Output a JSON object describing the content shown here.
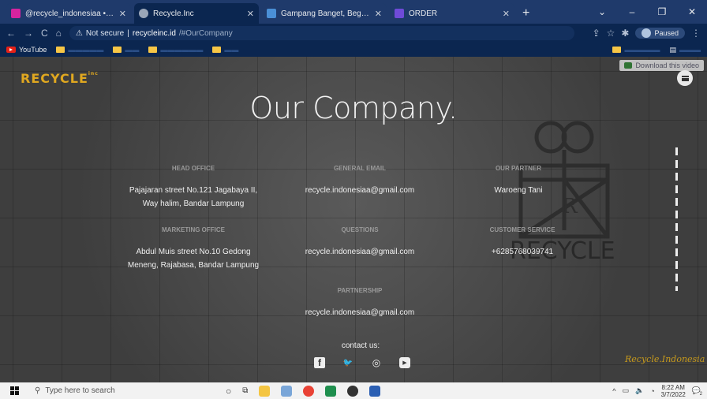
{
  "browser": {
    "tabs": [
      {
        "title": "@recycle_indonesiaa • Foto dan",
        "favicon_color": "#d6249f",
        "active": false
      },
      {
        "title": "Recycle.Inc",
        "favicon_color": "#9aa6b8",
        "active": true
      },
      {
        "title": "Gampang Banget, Begini Cara M",
        "favicon_color": "#4a8fd6",
        "active": false
      },
      {
        "title": "ORDER",
        "favicon_color": "#6f4bd8",
        "active": false
      }
    ],
    "new_tab_label": "+",
    "address": {
      "security": "Not secure",
      "host": "recycleinc.id",
      "path": "/#OurCompany"
    },
    "profile_status": "Paused",
    "bookmarks": [
      {
        "label": "YouTube",
        "type": "youtube"
      },
      {
        "label": "",
        "type": "folder"
      },
      {
        "label": "",
        "type": "folder"
      },
      {
        "label": "",
        "type": "folder"
      },
      {
        "label": "",
        "type": "folder"
      }
    ],
    "download_video_label": "Download this video"
  },
  "site": {
    "logo": "RECYCLE",
    "logo_mark": "inc",
    "heading": "Our Company.",
    "watermark_text": "RECYCLE",
    "signature": "Recycle.Indonesia",
    "contact_label": "contact us:",
    "social": [
      {
        "icon": "facebook-icon",
        "glyph": "f"
      },
      {
        "icon": "twitter-icon",
        "glyph": "🐦"
      },
      {
        "icon": "instagram-icon",
        "glyph": "◎"
      },
      {
        "icon": "youtube-icon",
        "glyph": "▶"
      }
    ]
  },
  "company": {
    "head_office": {
      "label": "HEAD OFFICE",
      "line1": "Pajajaran street No.121 Jagabaya II,",
      "line2": "Way halim, Bandar Lampung"
    },
    "marketing_office": {
      "label": "MARKETING OFFICE",
      "line1": "Abdul Muis street No.10 Gedong",
      "line2": "Meneng, Rajabasa, Bandar Lampung"
    },
    "general_email": {
      "label": "GENERAL EMAIL",
      "value": "recycle.indonesiaa@gmail.com"
    },
    "questions": {
      "label": "QUESTIONS",
      "value": "recycle.indonesiaa@gmail.com"
    },
    "partnership": {
      "label": "PARTNERSHIP",
      "value": "recycle.indonesiaa@gmail.com"
    },
    "our_partner": {
      "label": "OUR PARTNER",
      "value": "Waroeng Tani"
    },
    "customer_service": {
      "label": "CUSTOMER SERVICE",
      "value": "+6285768039741"
    }
  },
  "taskbar": {
    "search_placeholder": "Type here to search",
    "time": "8:22 AM",
    "date": "3/7/2022",
    "notification_count": "2"
  }
}
